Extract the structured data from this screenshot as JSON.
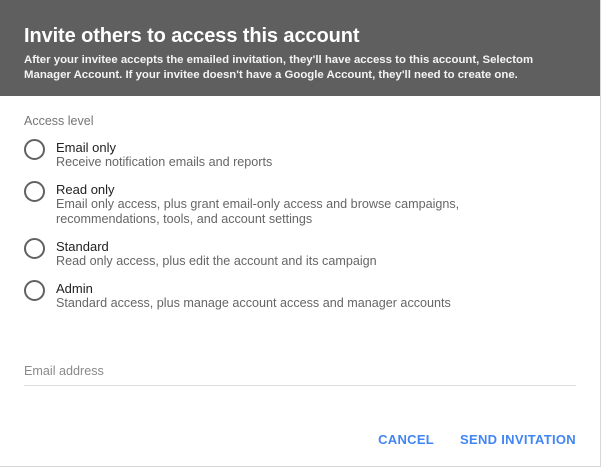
{
  "dialog": {
    "title": "Invite others to access this account",
    "subtitle": "After your invitee accepts the emailed invitation, they'll have access to this account, Selectom Manager Account. If your invitee doesn't have a Google Account, they'll need to create one."
  },
  "access": {
    "label": "Access level",
    "options": [
      {
        "title": "Email only",
        "desc": "Receive notification emails and reports",
        "selected": false
      },
      {
        "title": "Read only",
        "desc": "Email only access, plus grant email-only access and browse campaigns, recommendations, tools, and account settings",
        "selected": false
      },
      {
        "title": "Standard",
        "desc": "Read only access, plus edit the account and its campaign",
        "selected": false
      },
      {
        "title": "Admin",
        "desc": "Standard access, plus manage account access and manager accounts",
        "selected": false
      }
    ]
  },
  "email": {
    "placeholder": "Email address",
    "value": ""
  },
  "actions": {
    "cancel_label": "CANCEL",
    "send_label": "SEND INVITATION"
  },
  "colors": {
    "header_bg": "#5f5f5f",
    "accent": "#4285f4"
  },
  "icons": {
    "radio": "radio-unchecked-icon"
  }
}
